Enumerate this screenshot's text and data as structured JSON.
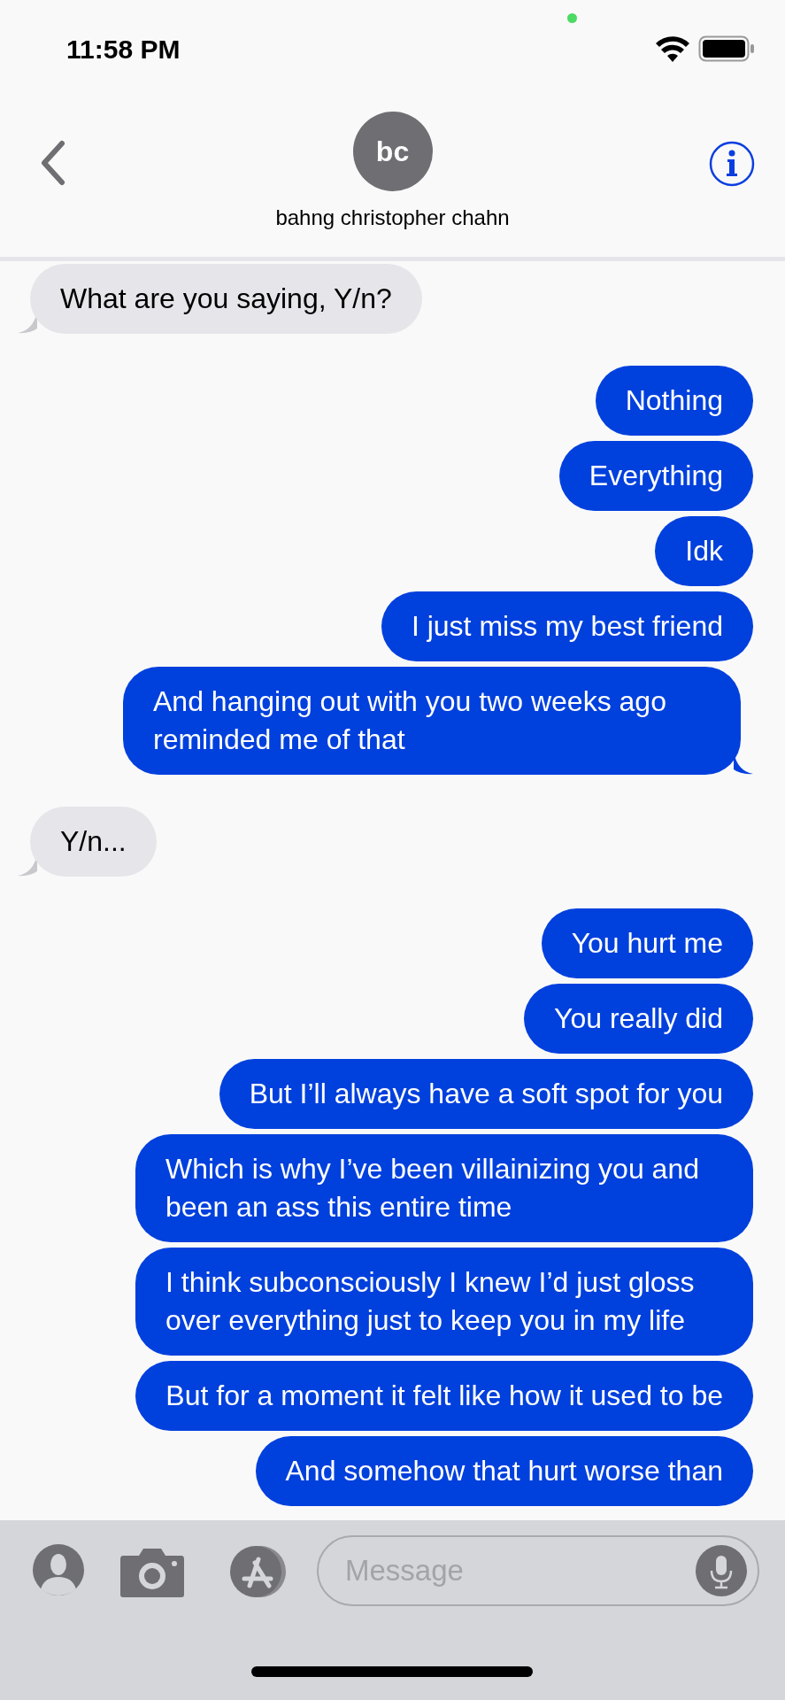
{
  "status_bar": {
    "time": "11:58 PM"
  },
  "header": {
    "avatar_initials": "bc",
    "contact_name": "bahng christopher chahn"
  },
  "messages": [
    {
      "kind": "received",
      "text": "What are you saying, Y/n?",
      "tail": true
    },
    {
      "kind": "sent",
      "text": "Nothing",
      "tail": false
    },
    {
      "kind": "sent",
      "text": "Everything",
      "tail": false
    },
    {
      "kind": "sent",
      "text": "Idk",
      "tail": false
    },
    {
      "kind": "sent",
      "text": "I just miss my best friend",
      "tail": false
    },
    {
      "kind": "sent",
      "text": "And hanging out with you two weeks ago reminded me of that",
      "tail": true
    },
    {
      "kind": "received",
      "text": "Y/n...",
      "tail": true
    },
    {
      "kind": "sent",
      "text": "You hurt me",
      "tail": false
    },
    {
      "kind": "sent",
      "text": "You really did",
      "tail": false
    },
    {
      "kind": "sent",
      "text": "But I’ll always have a soft spot for you",
      "tail": false
    },
    {
      "kind": "sent",
      "text": "Which is why I’ve been villainizing you and been an ass this entire time",
      "tail": false
    },
    {
      "kind": "sent",
      "text": "I think subconsciously I knew I’d just gloss over everything just to keep you in my life",
      "tail": false
    },
    {
      "kind": "sent",
      "text": "But for a moment it felt like how it used to be",
      "tail": false
    },
    {
      "kind": "sent",
      "text": "And somehow that hurt worse than",
      "tail": false
    }
  ],
  "composer": {
    "placeholder": "Message"
  }
}
